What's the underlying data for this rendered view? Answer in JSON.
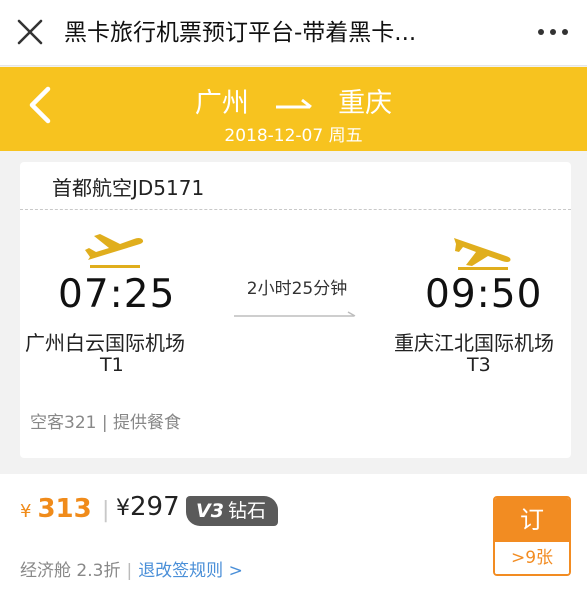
{
  "browser": {
    "title": "黑卡旅行机票预订平台-带着黑卡...",
    "close_icon": "close-icon",
    "more_icon": "more-icon"
  },
  "header": {
    "from": "广州",
    "to": "重庆",
    "date": "2018-12-07 周五",
    "back_icon": "back-chevron-icon",
    "bg_color": "#f7c31f"
  },
  "flight": {
    "airline": "首都航空JD5171",
    "departure": {
      "time": "07:25",
      "airport": "广州白云国际机场",
      "terminal": "T1"
    },
    "arrival": {
      "time": "09:50",
      "airport": "重庆江北国际机场",
      "terminal": "T3"
    },
    "duration": "2小时25分钟",
    "meta": "空客321 | 提供餐食"
  },
  "price": {
    "currency": "¥",
    "main_price": "313",
    "separator": "|",
    "vip_price": "297",
    "vip_level": "V3",
    "vip_label": "钻石",
    "cabin": "经济舱 2.3折",
    "cabin_sep": "|",
    "rules_label": "退改签规则 >",
    "accent_color": "#f08b1a"
  },
  "book": {
    "label": "订",
    "seats": ">9张"
  }
}
